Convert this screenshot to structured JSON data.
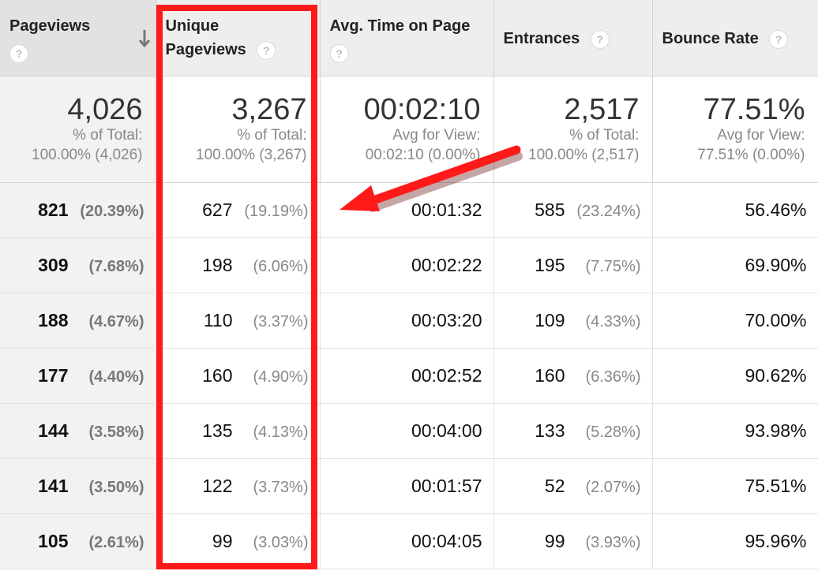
{
  "columns": [
    {
      "key": "pageviews",
      "label": "Pageviews",
      "help": "?"
    },
    {
      "key": "unique",
      "label_line1": "Unique",
      "label_line2": "Pageviews",
      "help": "?"
    },
    {
      "key": "avgtime",
      "label": "Avg. Time on Page",
      "help": "?"
    },
    {
      "key": "entrances",
      "label": "Entrances",
      "help": "?"
    },
    {
      "key": "bounce",
      "label": "Bounce Rate",
      "help": "?"
    }
  ],
  "totals": [
    {
      "value": "4,026",
      "sub1": "% of Total:",
      "sub2": "100.00% (4,026)"
    },
    {
      "value": "3,267",
      "sub1": "% of Total:",
      "sub2": "100.00% (3,267)"
    },
    {
      "value": "00:02:10",
      "sub1": "Avg for View:",
      "sub2": "00:02:10 (0.00%)"
    },
    {
      "value": "2,517",
      "sub1": "% of Total:",
      "sub2": "100.00% (2,517)"
    },
    {
      "value": "77.51%",
      "sub1": "Avg for View:",
      "sub2": "77.51% (0.00%)"
    }
  ],
  "rows": [
    {
      "pv": "821",
      "pv_pct": "(20.39%)",
      "upv": "627",
      "upv_pct": "(19.19%)",
      "time": "00:01:32",
      "ent": "585",
      "ent_pct": "(23.24%)",
      "bounce": "56.46%"
    },
    {
      "pv": "309",
      "pv_pct": "(7.68%)",
      "upv": "198",
      "upv_pct": "(6.06%)",
      "time": "00:02:22",
      "ent": "195",
      "ent_pct": "(7.75%)",
      "bounce": "69.90%"
    },
    {
      "pv": "188",
      "pv_pct": "(4.67%)",
      "upv": "110",
      "upv_pct": "(3.37%)",
      "time": "00:03:20",
      "ent": "109",
      "ent_pct": "(4.33%)",
      "bounce": "70.00%"
    },
    {
      "pv": "177",
      "pv_pct": "(4.40%)",
      "upv": "160",
      "upv_pct": "(4.90%)",
      "time": "00:02:52",
      "ent": "160",
      "ent_pct": "(6.36%)",
      "bounce": "90.62%"
    },
    {
      "pv": "144",
      "pv_pct": "(3.58%)",
      "upv": "135",
      "upv_pct": "(4.13%)",
      "time": "00:04:00",
      "ent": "133",
      "ent_pct": "(5.28%)",
      "bounce": "93.98%"
    },
    {
      "pv": "141",
      "pv_pct": "(3.50%)",
      "upv": "122",
      "upv_pct": "(3.73%)",
      "time": "00:01:57",
      "ent": "52",
      "ent_pct": "(2.07%)",
      "bounce": "75.51%"
    },
    {
      "pv": "105",
      "pv_pct": "(2.61%)",
      "upv": "99",
      "upv_pct": "(3.03%)",
      "time": "00:04:05",
      "ent": "99",
      "ent_pct": "(3.93%)",
      "bounce": "95.96%"
    }
  ],
  "icons": {
    "sort": "arrow-down-icon",
    "help": "question-mark-icon"
  },
  "colors": {
    "highlight": "#ff1a1a",
    "header_bg": "#eeeeee",
    "sorted_bg": "#f2f2f2"
  }
}
